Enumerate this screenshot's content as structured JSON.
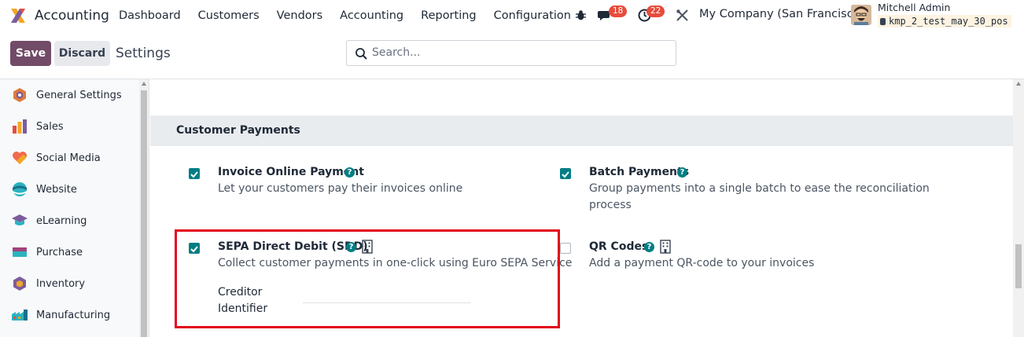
{
  "app": {
    "name": "Accounting"
  },
  "menu": [
    "Dashboard",
    "Customers",
    "Vendors",
    "Accounting",
    "Reporting",
    "Configuration"
  ],
  "systray": {
    "messages_count": "18",
    "activities_count": "22",
    "company": "My Company (San Francisco)",
    "user_name": "Mitchell Admin",
    "database": "kmp_2_test_may_30_pos"
  },
  "controls": {
    "save_label": "Save",
    "discard_label": "Discard",
    "breadcrumb": "Settings",
    "search_placeholder": "Search..."
  },
  "sidebar": {
    "items": [
      {
        "label": "General Settings",
        "icon": "general-settings-icon"
      },
      {
        "label": "Sales",
        "icon": "sales-icon"
      },
      {
        "label": "Social Media",
        "icon": "social-media-icon"
      },
      {
        "label": "Website",
        "icon": "website-icon"
      },
      {
        "label": "eLearning",
        "icon": "elearning-icon"
      },
      {
        "label": "Purchase",
        "icon": "purchase-icon"
      },
      {
        "label": "Inventory",
        "icon": "inventory-icon"
      },
      {
        "label": "Manufacturing",
        "icon": "manufacturing-icon"
      }
    ]
  },
  "section": {
    "title": "Customer Payments"
  },
  "settings": {
    "invoice_online": {
      "title": "Invoice Online Payment",
      "desc": "Let your customers pay their invoices online",
      "checked": true
    },
    "batch_payments": {
      "title": "Batch Payments",
      "desc_line1": "Group payments into a single batch to ease the reconciliation",
      "desc_line2": "process",
      "checked": true
    },
    "sepa": {
      "title": "SEPA Direct Debit (SDD)",
      "desc": "Collect customer payments in one-click using Euro SEPA Service",
      "field_label_1": "Creditor",
      "field_label_2": "Identifier",
      "field_value": "",
      "checked": true
    },
    "qr_codes": {
      "title": "QR Codes",
      "desc": "Add a payment QR-code to your invoices",
      "checked": false
    }
  },
  "colors": {
    "brand": "#714b67",
    "accent": "#017e84",
    "highlight": "#e2061b",
    "badge": "#e74c3c"
  }
}
